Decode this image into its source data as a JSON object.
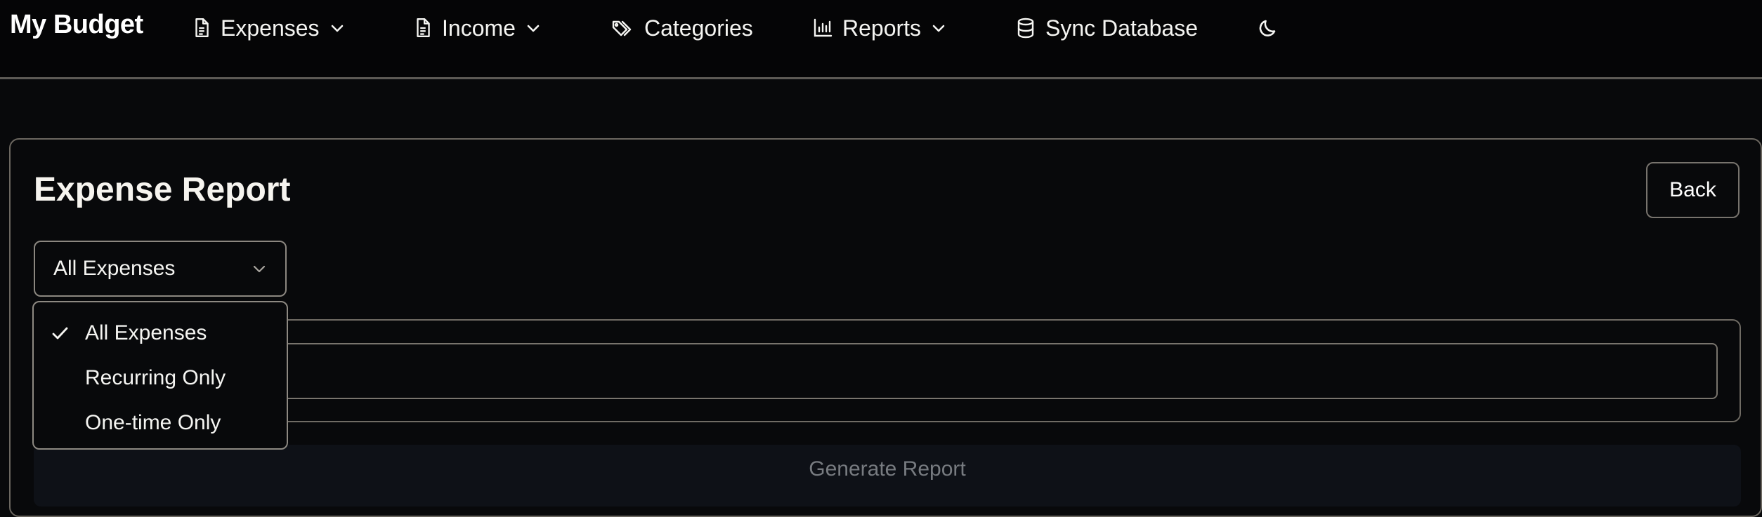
{
  "app": {
    "title": "My Budget"
  },
  "nav": {
    "items": [
      {
        "label": "Expenses",
        "icon": "document-icon",
        "has_dropdown": true
      },
      {
        "label": "Income",
        "icon": "document-icon",
        "has_dropdown": true
      },
      {
        "label": "Categories",
        "icon": "tags-icon",
        "has_dropdown": false
      },
      {
        "label": "Reports",
        "icon": "bar-chart-icon",
        "has_dropdown": true
      },
      {
        "label": "Sync Database",
        "icon": "database-icon",
        "has_dropdown": false
      }
    ],
    "theme_toggle_icon": "moon-icon"
  },
  "page": {
    "title": "Expense Report",
    "back_label": "Back"
  },
  "filter": {
    "selected": "All Expenses",
    "options": [
      {
        "label": "All Expenses",
        "selected": true
      },
      {
        "label": "Recurring Only",
        "selected": false
      },
      {
        "label": "One-time Only",
        "selected": false
      }
    ]
  },
  "input": {
    "value": "",
    "placeholder": ""
  },
  "actions": {
    "generate_label": "Generate Report"
  },
  "colors": {
    "background": "#08090b",
    "topbar": "#050506",
    "border": "#77736d",
    "text": "#f5f5f2",
    "muted": "#777b80"
  }
}
